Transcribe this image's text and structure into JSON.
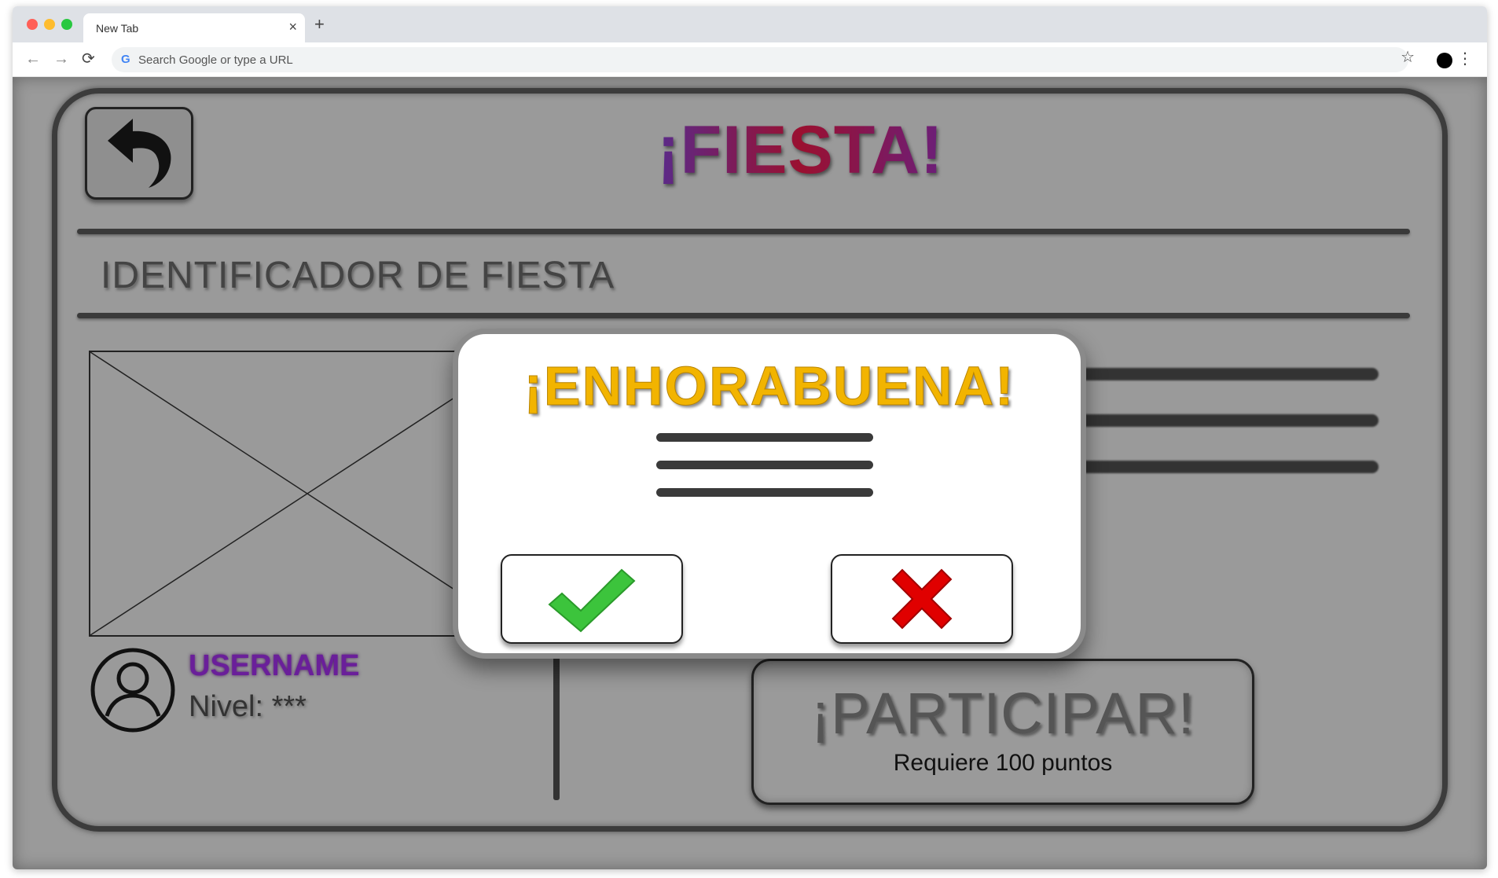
{
  "browser": {
    "tab_title": "New Tab",
    "tab_close": "×",
    "new_tab": "+",
    "address_placeholder": "Search Google or type a URL",
    "google_glyph": "G",
    "back": "←",
    "forward": "→",
    "reload": "⟳",
    "star": "☆",
    "menu": "⋮"
  },
  "page": {
    "title": "¡FIESTA!",
    "section_label": "IDENTIFICADOR DE FIESTA",
    "user": {
      "username": "USERNAME",
      "level": "Nivel: ***"
    },
    "participar": {
      "title": "¡PARTICIPAR!",
      "subtitle": "Requiere 100 puntos"
    }
  },
  "modal": {
    "title": "¡ENHORABUENA!",
    "confirm_icon": "check-icon",
    "cancel_icon": "x-icon"
  },
  "colors": {
    "page_background": "#9a9a9a",
    "title_purple": "#6b1f7a",
    "title_red": "#9a1030",
    "modal_title_gold": "#f2b400",
    "confirm_green": "#3cc43c",
    "cancel_red": "#e00000",
    "username_purple": "#6a1f9a"
  }
}
